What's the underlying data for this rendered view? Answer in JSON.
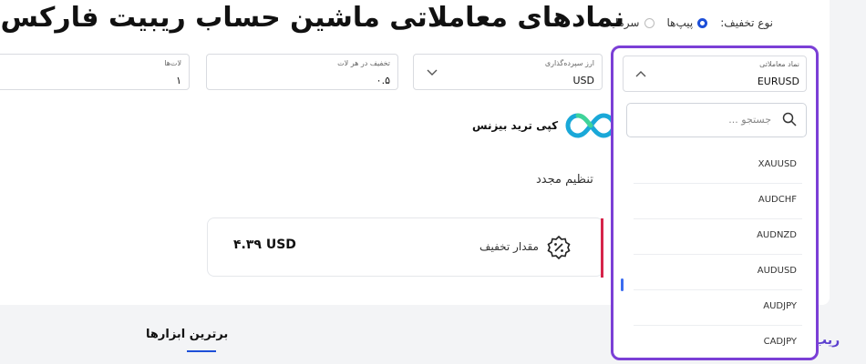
{
  "title": "نمادهای معاملاتی ماشین حساب ریبیت فارکس",
  "discount_type": {
    "label": "نوع تخفیف:",
    "options": [
      {
        "label": "پیپ‌ها",
        "checked": true
      },
      {
        "label": "سرمایه",
        "checked": false
      }
    ]
  },
  "fields": {
    "symbol": {
      "label": "نماد معاملاتی",
      "value": "EURUSD"
    },
    "currency": {
      "label": "ارز سپرده‌گذاری",
      "value": "USD"
    },
    "discount": {
      "label": "تخفیف در هر لات",
      "value": "۰.۵"
    },
    "lots": {
      "label": "لات‌ها",
      "value": "۱"
    }
  },
  "logo_text": "کپی ترید بیزنس",
  "reset_label": "تنظیم مجدد",
  "result": {
    "label": "مقدار تخفیف",
    "amount": "۴.۳۹ USD"
  },
  "dropdown": {
    "search_placeholder": "جستجو ...",
    "items": [
      "XAUUSD",
      "AUDCHF",
      "AUDNZD",
      "AUDUSD",
      "AUDJPY",
      "CADJPY"
    ]
  },
  "tabs": {
    "top_instruments": "برترین ابزارها"
  },
  "brand_partial": "ریب",
  "colors": {
    "accent": "#1d4fd8",
    "highlight_border": "#7b3fd6",
    "result_bar": "#d6244a"
  }
}
